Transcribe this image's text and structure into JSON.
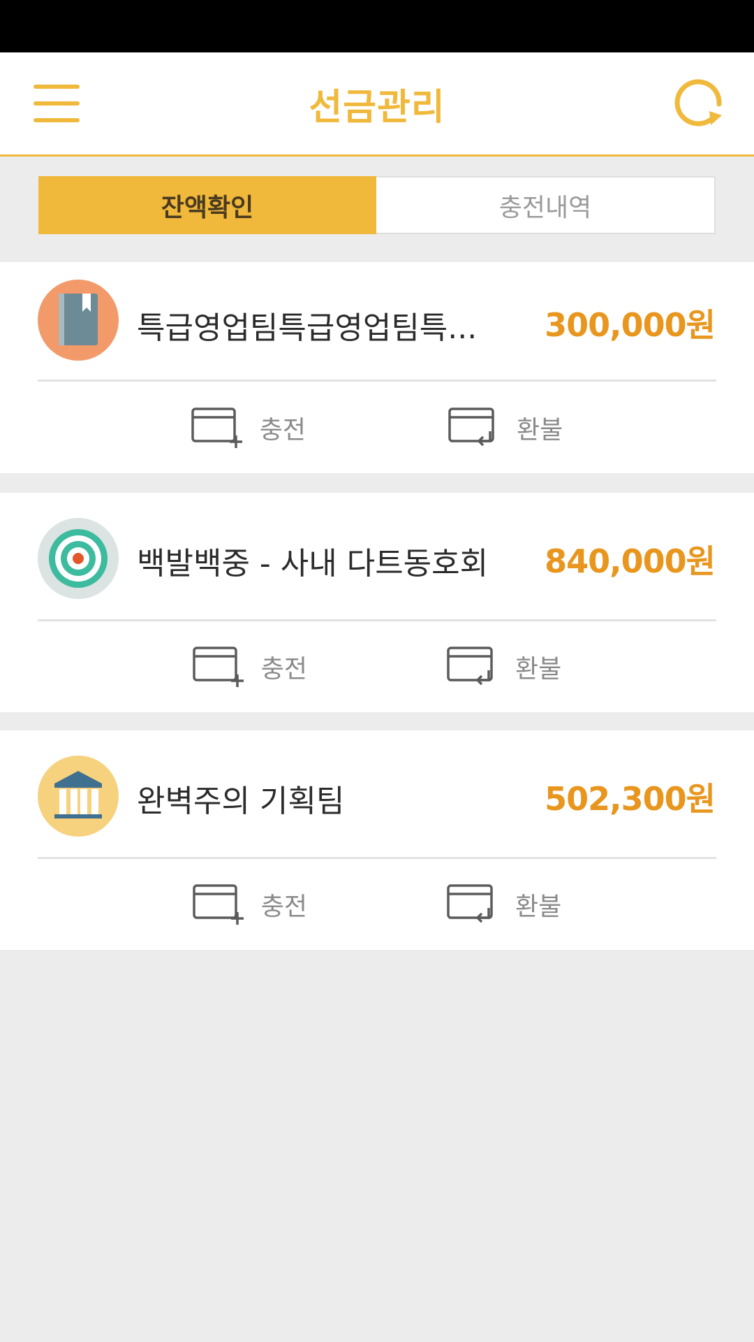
{
  "header": {
    "title": "선금관리",
    "menu_icon": "hamburger-menu-icon",
    "refresh_icon": "refresh-icon"
  },
  "tabs": [
    {
      "label": "잔액확인",
      "active": true
    },
    {
      "label": "충전내역",
      "active": false
    }
  ],
  "accounts": [
    {
      "name": "특급영업팀특급영업팀특...",
      "balance": "300,000원",
      "icon": "book-icon",
      "icon_bg": "#f39a6b",
      "charge_label": "충전",
      "refund_label": "환불"
    },
    {
      "name": "백발백중 - 사내 다트동호회",
      "balance": "840,000원",
      "icon": "target-icon",
      "icon_bg": "#dbe3e3",
      "charge_label": "충전",
      "refund_label": "환불"
    },
    {
      "name": "완벽주의 기획팀",
      "balance": "502,300원",
      "icon": "bank-building-icon",
      "icon_bg": "#f6d27f",
      "charge_label": "충전",
      "refund_label": "환불"
    }
  ],
  "colors": {
    "accent": "#f0b93b",
    "balance": "#e8961e",
    "background": "#ececec"
  }
}
